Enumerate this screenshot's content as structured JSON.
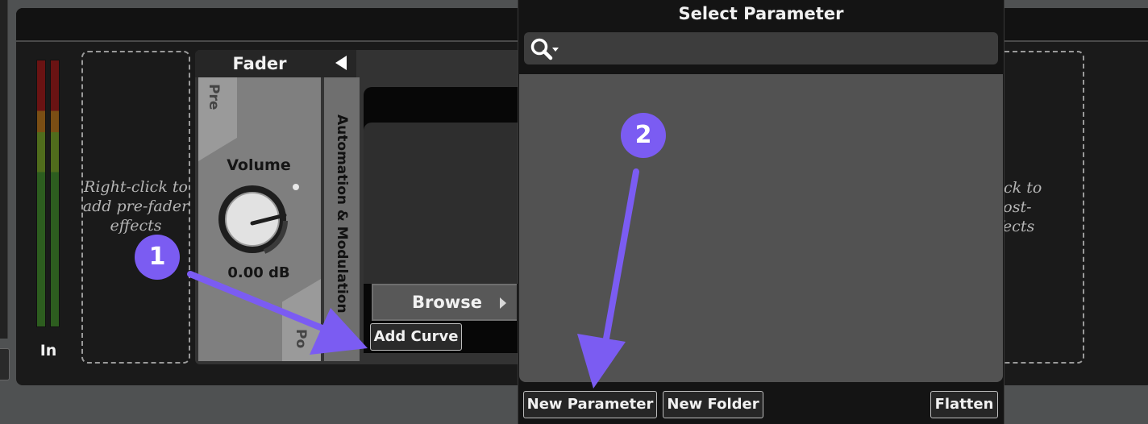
{
  "meter": {
    "label": "In"
  },
  "pre_fader_slot": {
    "text": "Right-click to add pre-fader effects"
  },
  "post_fader_slot": {
    "text": "ight-click to\nadd post-\nler effects"
  },
  "fader": {
    "title": "Fader",
    "pre_tab": "Pre",
    "post_tab": "Po",
    "knob_label": "Volume",
    "knob_value": "0.00 dB"
  },
  "automation": {
    "side_label": "Automation & Modulation",
    "browse_label": "Browse",
    "add_curve_label": "Add Curve"
  },
  "select_parameter": {
    "title": "Select Parameter",
    "search_value": "",
    "buttons": {
      "new_parameter": "New Parameter",
      "new_folder": "New Folder",
      "flatten": "Flatten"
    }
  },
  "annotations": {
    "step_1": "1",
    "step_2": "2",
    "accent_color": "#7b5cf2"
  }
}
